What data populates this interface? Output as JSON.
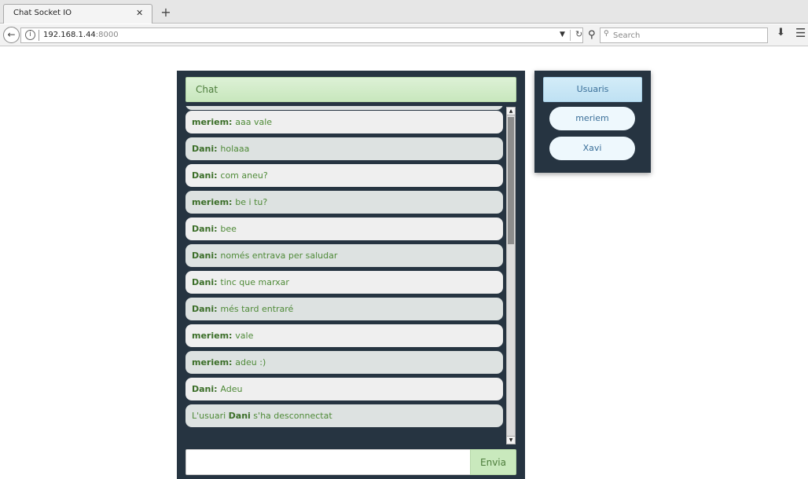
{
  "browser": {
    "tab_title": "Chat Socket IO",
    "tab_close": "✕",
    "new_tab": "+",
    "url_host": "192.168.1.44",
    "url_port": ":8000",
    "search_placeholder": "Search"
  },
  "chat": {
    "header": "Chat",
    "messages": [
      {
        "user": "meriem",
        "text": "aaa vale",
        "shade": "light"
      },
      {
        "user": "Dani",
        "text": "holaaa",
        "shade": "dark"
      },
      {
        "user": "Dani",
        "text": "com aneu?",
        "shade": "light"
      },
      {
        "user": "meriem",
        "text": "be i tu?",
        "shade": "dark"
      },
      {
        "user": "Dani",
        "text": "bee",
        "shade": "light"
      },
      {
        "user": "Dani",
        "text": "només entrava per saludar",
        "shade": "dark"
      },
      {
        "user": "Dani",
        "text": "tinc que marxar",
        "shade": "light"
      },
      {
        "user": "Dani",
        "text": "més tard entraré",
        "shade": "dark"
      },
      {
        "user": "meriem",
        "text": "vale",
        "shade": "light"
      },
      {
        "user": "meriem",
        "text": "adeu :)",
        "shade": "dark"
      },
      {
        "user": "Dani",
        "text": "Adeu",
        "shade": "light"
      }
    ],
    "system_message": {
      "prefix": "L'usuari ",
      "user": "Dani",
      "suffix": " s'ha desconnectat"
    },
    "input_value": "",
    "send_label": "Envia"
  },
  "users": {
    "header": "Usuaris",
    "list": [
      "meriem",
      "Xavi"
    ]
  },
  "colors": {
    "panel_bg": "#263441",
    "accent_green": "#4e8a37",
    "accent_blue": "#3a6f99"
  }
}
